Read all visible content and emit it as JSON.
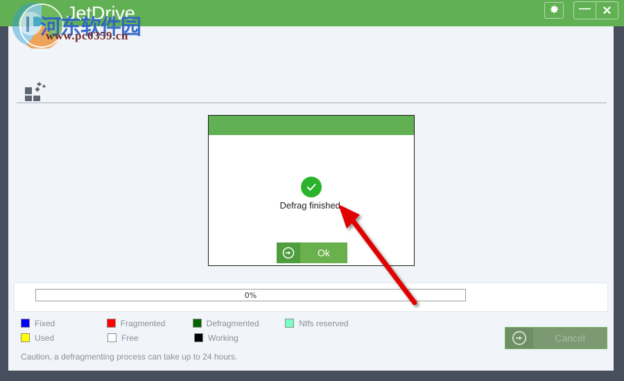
{
  "window": {
    "title": "JetDrive",
    "controls": [
      {
        "name": "settings-button",
        "glyph": "⚙"
      },
      {
        "name": "minimize-button",
        "glyph": "—"
      },
      {
        "name": "close-button",
        "glyph": "✕"
      }
    ]
  },
  "toolbar": {
    "icon_name": "defrag-blocks-icon"
  },
  "dialog": {
    "message": "Defrag finished.",
    "status_icon": "check-circle-icon",
    "ok_label": "Ok",
    "ok_icon": "arrow-right-circle-icon"
  },
  "progress": {
    "value": 0,
    "text": "0%"
  },
  "legend": {
    "rows": [
      [
        {
          "label": "Fixed",
          "color": "#0000ff"
        },
        {
          "label": "Fragmented",
          "color": "#ff0000"
        },
        {
          "label": "Defragmented",
          "color": "#006400"
        },
        {
          "label": "Ntfs reserved",
          "color": "#7affc8"
        }
      ],
      [
        {
          "label": "Used",
          "color": "#ffff00"
        },
        {
          "label": "Free",
          "color": "#ffffff"
        },
        {
          "label": "Working",
          "color": "#000000"
        }
      ]
    ]
  },
  "cancel": {
    "label": "Cancel",
    "icon": "arrow-right-circle-icon",
    "disabled": true
  },
  "caution": {
    "text": "Caution, a defragmenting process can take up to 24 hours."
  },
  "watermark": {
    "site": "www.pc0359.cn",
    "cn_text": "河东软件园"
  },
  "colors": {
    "brand_green": "#62b054",
    "dark_chrome": "#474f5e",
    "panel_bg": "#f1f4f8",
    "annotation_red": "#e00000"
  }
}
